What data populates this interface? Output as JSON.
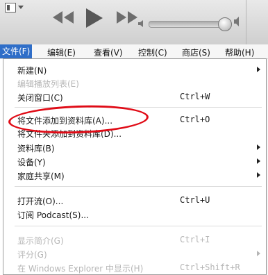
{
  "toolbar": {
    "volume_level": 0.95
  },
  "menubar": {
    "items": [
      {
        "label": "文件(F)"
      },
      {
        "label": "编辑(E)"
      },
      {
        "label": "查看(V)"
      },
      {
        "label": "控制(C)"
      },
      {
        "label": "商店(S)"
      },
      {
        "label": "帮助(H)"
      }
    ]
  },
  "file_menu": {
    "items": [
      {
        "label": "新建(N)",
        "shortcut": "",
        "enabled": true,
        "submenu": true
      },
      {
        "label": "编辑播放列表(E)",
        "shortcut": "",
        "enabled": false,
        "submenu": false
      },
      {
        "label": "关闭窗口(C)",
        "shortcut": "Ctrl+W",
        "enabled": true,
        "submenu": false
      },
      {
        "label": "将文件添加到资料库(A)...",
        "shortcut": "Ctrl+O",
        "enabled": true,
        "submenu": false,
        "highlighted": true
      },
      {
        "label": "将文件夹添加到资料库(D)...",
        "shortcut": "",
        "enabled": true,
        "submenu": false
      },
      {
        "label": "资料库(B)",
        "shortcut": "",
        "enabled": true,
        "submenu": true
      },
      {
        "label": "设备(Y)",
        "shortcut": "",
        "enabled": true,
        "submenu": true
      },
      {
        "label": "家庭共享(M)",
        "shortcut": "",
        "enabled": true,
        "submenu": true
      },
      {
        "label": "打开流(O)...",
        "shortcut": "Ctrl+U",
        "enabled": true,
        "submenu": false
      },
      {
        "label": "订阅 Podcast(S)...",
        "shortcut": "",
        "enabled": true,
        "submenu": false
      },
      {
        "label": "显示简介(G)",
        "shortcut": "Ctrl+I",
        "enabled": false,
        "submenu": false
      },
      {
        "label": "评分(G)",
        "shortcut": "",
        "enabled": false,
        "submenu": true
      },
      {
        "label": "在 Windows Explorer 中显示(H)",
        "shortcut": "Ctrl+Shift+R",
        "enabled": false,
        "submenu": false
      }
    ]
  },
  "colors": {
    "menubar_active": "#2f6ec8",
    "highlight_circle": "#e00b16",
    "disabled_text": "#b6b6b6"
  }
}
